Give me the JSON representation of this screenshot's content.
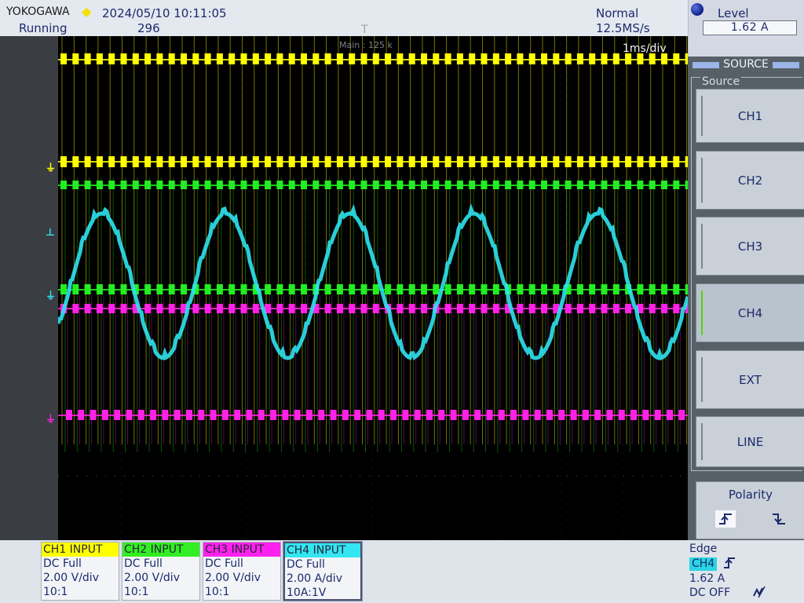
{
  "header": {
    "brand": "YOKOGAWA",
    "datetime": "2024/05/10 10:11:05",
    "run_state": "Running",
    "acq_count": "296",
    "trigger_mode": "Normal",
    "sample_rate": "12.5MS/s"
  },
  "level": {
    "title": "Level",
    "value": "1.62 A"
  },
  "display": {
    "main_label": "Main : 125 k",
    "time_div": "1ms/div",
    "trigger_marker": "T"
  },
  "menu": {
    "title": "SOURCE",
    "group_label": "Source",
    "buttons": [
      "CH1",
      "CH2",
      "CH3",
      "CH4",
      "EXT",
      "LINE"
    ],
    "active": "CH4",
    "polarity_label": "Polarity"
  },
  "channels": [
    {
      "title": "CH1  INPUT",
      "coupling": "DC Full",
      "scale": "2.00 V/div",
      "probe": "10:1",
      "color": "#ffff00"
    },
    {
      "title": "CH2  INPUT",
      "coupling": "DC Full",
      "scale": "2.00 V/div",
      "probe": "10:1",
      "color": "#33ee22"
    },
    {
      "title": "CH3  INPUT",
      "coupling": "DC Full",
      "scale": "2.00 V/div",
      "probe": "10:1",
      "color": "#ff22ee"
    },
    {
      "title": "CH4  INPUT",
      "coupling": "DC Full",
      "scale": "2.00 A/div",
      "probe": "10A:1V",
      "color": "#33e6f2"
    }
  ],
  "trigger_info": {
    "type": "Edge",
    "source": "CH4",
    "level": "1.62 A",
    "filter": "DC OFF"
  },
  "colors": {
    "ch1": "#ffff00",
    "ch2": "#22ee22",
    "ch3": "#ff22e6",
    "ch4": "#2ee3f0",
    "display_bg": "#000000",
    "grid": "#5a5a5a"
  }
}
